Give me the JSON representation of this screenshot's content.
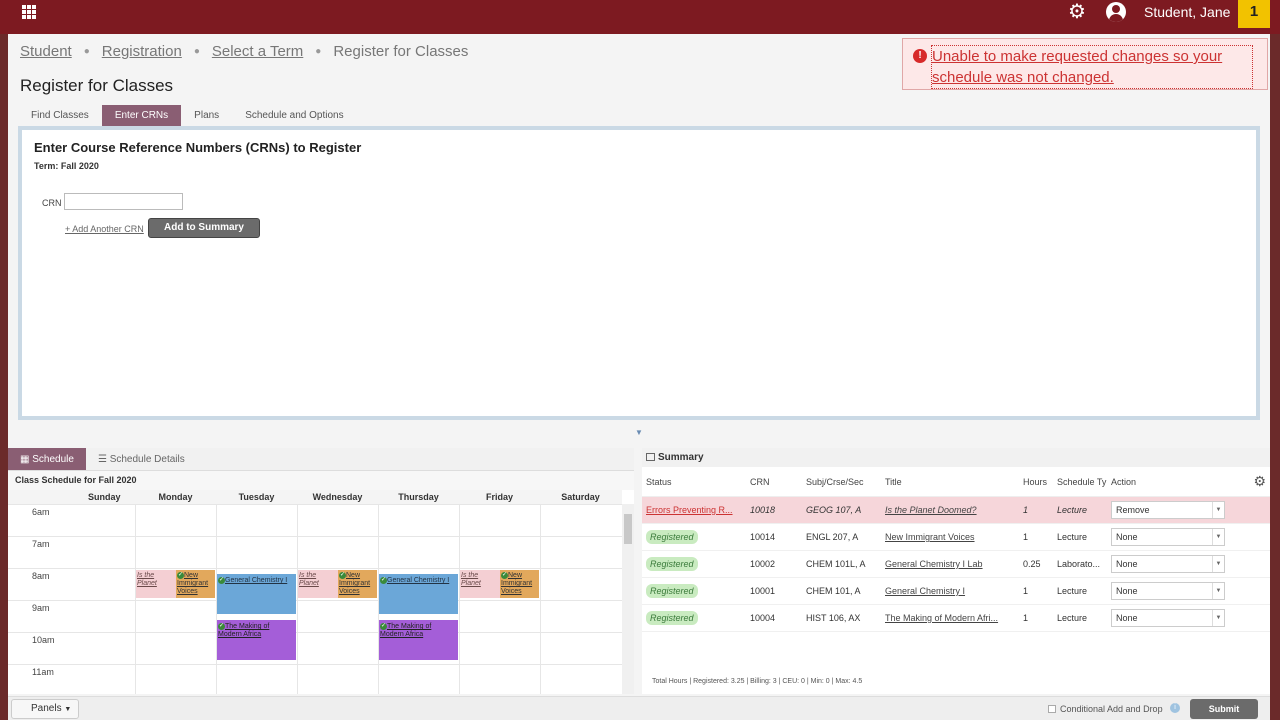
{
  "topbar": {
    "user_name": "Student, Jane",
    "notification_count": "1",
    "colors": {
      "brand": "#7d1a21",
      "badge": "#f2c200"
    }
  },
  "breadcrumb": [
    "Student",
    "Registration",
    "Select a Term",
    "Register for Classes"
  ],
  "page_title": "Register for Classes",
  "error_message": "Unable to make requested changes so your schedule was not changed.",
  "tabs": [
    "Find Classes",
    "Enter CRNs",
    "Plans",
    "Schedule and Options"
  ],
  "enter_crns": {
    "heading": "Enter Course Reference Numbers (CRNs) to Register",
    "term": "Term: Fall 2020",
    "crn_label": "CRN",
    "crn_value": "",
    "add_another": "+ Add Another CRN",
    "add_button": "Add to Summary"
  },
  "schedule": {
    "tab_schedule": "Schedule",
    "tab_details": "Schedule Details",
    "title": "Class Schedule for Fall 2020",
    "days": [
      "Sunday",
      "Monday",
      "Tuesday",
      "Wednesday",
      "Thursday",
      "Friday",
      "Saturday"
    ],
    "hours": [
      "6am",
      "7am",
      "8am",
      "9am",
      "10am",
      "11am"
    ],
    "events": {
      "planet": "Is the Planet",
      "voices": "New Immigrant Voices",
      "chem": "General Chemistry I",
      "africa": "The Making of Modern Africa"
    }
  },
  "summary": {
    "title": "Summary",
    "columns": [
      "Status",
      "CRN",
      "Subj/Crse/Sec",
      "Title",
      "Hours",
      "Schedule Ty",
      "Action"
    ],
    "rows": [
      {
        "status": "Errors Preventing R...",
        "crn": "10018",
        "subj": "GEOG 107, A",
        "title": "Is the Planet Doomed?",
        "hours": "1",
        "type": "Lecture",
        "action": "Remove"
      },
      {
        "status": "Registered",
        "crn": "10014",
        "subj": "ENGL 207, A",
        "title": "New Immigrant Voices",
        "hours": "1",
        "type": "Lecture",
        "action": "None"
      },
      {
        "status": "Registered",
        "crn": "10002",
        "subj": "CHEM 101L, A",
        "title": "General Chemistry I Lab",
        "hours": "0.25",
        "type": "Laborato...",
        "action": "None"
      },
      {
        "status": "Registered",
        "crn": "10001",
        "subj": "CHEM 101, A",
        "title": "General Chemistry I",
        "hours": "1",
        "type": "Lecture",
        "action": "None"
      },
      {
        "status": "Registered",
        "crn": "10004",
        "subj": "HIST 106, AX",
        "title": "The Making of Modern Afri...",
        "hours": "1",
        "type": "Lecture",
        "action": "None"
      }
    ],
    "totals": "Total Hours | Registered: 3.25 | Billing: 3 | CEU: 0 | Min: 0 | Max: 4.5"
  },
  "footer": {
    "panels": "Panels",
    "conditional": "Conditional Add and Drop",
    "submit": "Submit"
  }
}
